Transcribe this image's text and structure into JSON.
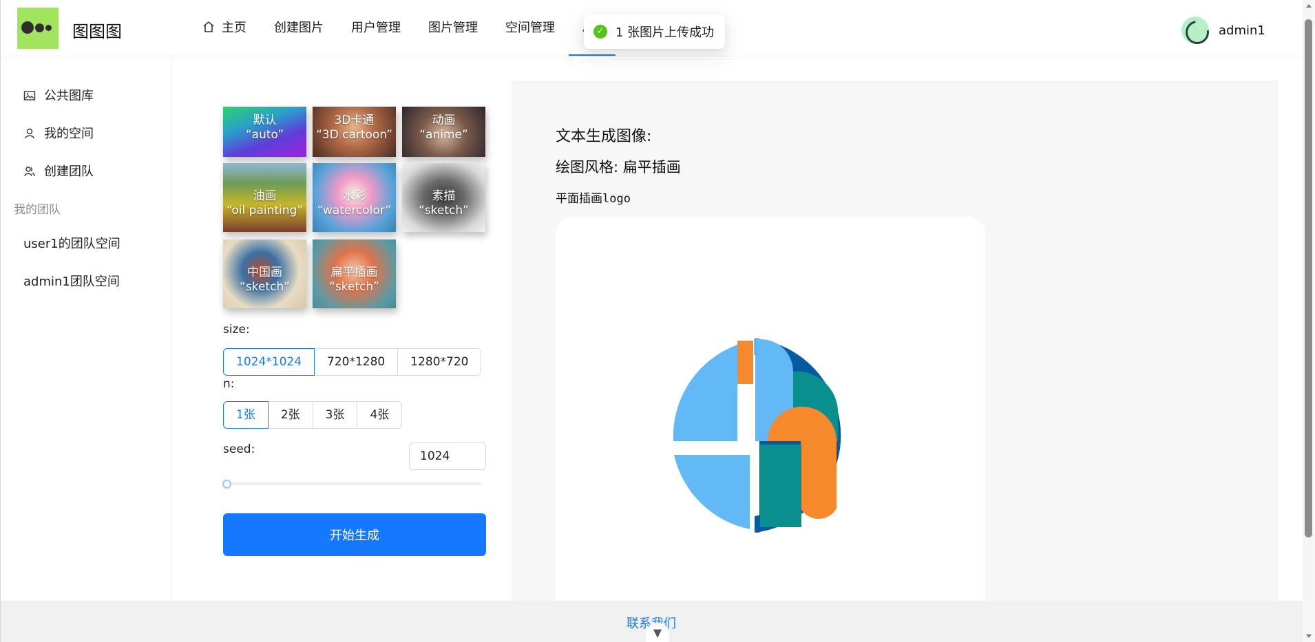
{
  "app": {
    "title": "图图图"
  },
  "nav": {
    "items": [
      {
        "label": "主页",
        "icon": "home-icon"
      },
      {
        "label": "创建图片"
      },
      {
        "label": "用户管理"
      },
      {
        "label": "图片管理"
      },
      {
        "label": "空间管理"
      },
      {
        "label": "A",
        "active": true
      }
    ]
  },
  "user": {
    "name": "admin1"
  },
  "toast": {
    "message": "1 张图片上传成功",
    "icon": "check-circle-icon",
    "color": "#52c41a"
  },
  "sidebar": {
    "items": [
      {
        "label": "公共图库",
        "icon": "picture-icon"
      },
      {
        "label": "我的空间",
        "icon": "user-icon"
      },
      {
        "label": "创建团队",
        "icon": "team-icon"
      }
    ],
    "group_title": "我的团队",
    "teams": [
      {
        "label": "user1的团队空间"
      },
      {
        "label": "admin1团队空间"
      }
    ]
  },
  "styles": [
    {
      "name": "默认",
      "value": "“auto”"
    },
    {
      "name": "3D卡通",
      "value": "“3D cartoon”"
    },
    {
      "name": "动画",
      "value": "“anime”"
    },
    {
      "name": "油画",
      "value": "“oil painting”"
    },
    {
      "name": "水彩",
      "value": "“watercolor”"
    },
    {
      "name": "素描",
      "value": "“sketch”"
    },
    {
      "name": "中国画",
      "value": "“sketch”"
    },
    {
      "name": "扁平插画",
      "value": "“sketch”"
    }
  ],
  "form": {
    "size_label": "size:",
    "sizes": [
      "1024*1024",
      "720*1280",
      "1280*720"
    ],
    "size_selected": "1024*1024",
    "n_label": "n:",
    "counts": [
      "1张",
      "2张",
      "3张",
      "4张"
    ],
    "count_selected": "1张",
    "seed_label": "seed:",
    "seed_value": "1024",
    "seed_slider_fraction": 0,
    "generate_label": "开始生成"
  },
  "result": {
    "title": "文本生成图像:",
    "style_line": "绘图风格: 扁平插画",
    "prompt": "平面插画logo"
  },
  "footer": {
    "link": "联系我们"
  },
  "colors": {
    "accent": "#1677ff",
    "logo_bg": "#a3e45f"
  }
}
